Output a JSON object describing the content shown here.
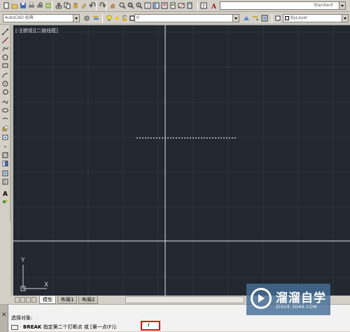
{
  "workspace": {
    "value": "AutoCAD 经典"
  },
  "layer": {
    "value": "0"
  },
  "layer_color": {
    "value": "ByLayer"
  },
  "text_style": {
    "value": "Standard"
  },
  "viewport": {
    "label": "[-][俯视][二维线框]"
  },
  "ucs": {
    "x_label": "X",
    "y_label": "Y"
  },
  "tabs": [
    {
      "label": "模型"
    },
    {
      "label": "布局1"
    },
    {
      "label": "布局2"
    }
  ],
  "command": {
    "line1": "选择对象:",
    "line2_cmd": "BREAK",
    "line2_text": "指定第二个打断点 或 [第一点(F)]:",
    "input": "f"
  },
  "watermark": {
    "title": "溜溜自学",
    "subtitle": "ZIXUE.3D66.COM"
  },
  "colors": {
    "canvas": "#212830",
    "grid": "#2c3540",
    "crosshair": "#e6e6e6",
    "highlight": "#e01010"
  },
  "icons": {
    "toolbar": [
      "new-icon",
      "open-icon",
      "save-icon",
      "print-icon",
      "print-preview-icon",
      "publish-icon",
      "cut-icon",
      "copy-icon",
      "paste-icon",
      "match-properties-icon",
      "undo-icon",
      "redo-icon",
      "pan-icon",
      "zoom-realtime-icon",
      "zoom-window-icon",
      "zoom-previous-icon",
      "properties-icon",
      "design-center-icon",
      "tool-palettes-icon",
      "sheet-set-icon",
      "markup-icon",
      "calculator-icon",
      "help-icon",
      "text-style-icon"
    ],
    "palette": [
      "line-icon",
      "construction-line-icon",
      "polyline-icon",
      "polygon-icon",
      "rectangle-icon",
      "arc-icon",
      "circle-icon",
      "revision-cloud-icon",
      "spline-icon",
      "ellipse-icon",
      "ellipse-arc-icon",
      "insert-block-icon",
      "make-block-icon",
      "point-icon",
      "hatch-icon",
      "gradient-icon",
      "region-icon",
      "table-icon",
      "multiline-text-icon",
      "add-selected-icon"
    ]
  }
}
